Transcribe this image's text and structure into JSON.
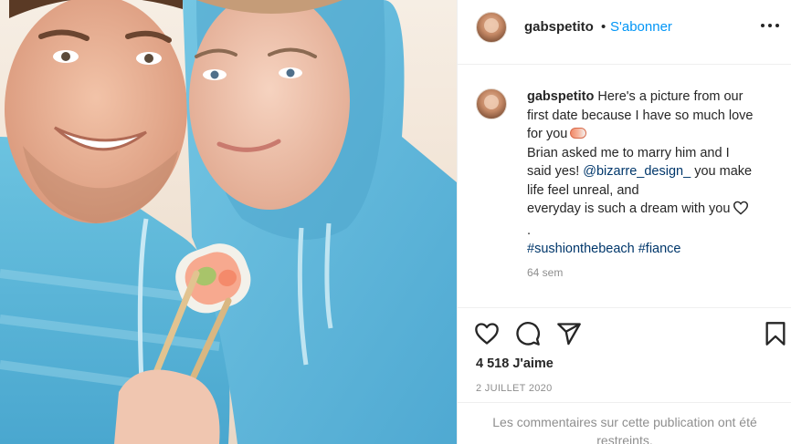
{
  "post": {
    "photo_label": "couple-selfie-photo",
    "author": {
      "username": "gabspetito",
      "follow_separator": "•",
      "follow_label": "S'abonner",
      "more_label": "•••"
    },
    "caption": {
      "username": "gabspetito",
      "line1": "Here's a picture from our",
      "line2": "first date because I have so much love",
      "line3": "for you",
      "line4": "Brian asked me to marry him and I",
      "line5_start": "said yes!",
      "mention": "@bizarre_design_",
      "line5_end": "you make",
      "line6": "life feel unreal, and",
      "line7": "everyday is such a dream with you",
      "line8": ".",
      "hashtags": "#sushionthebeach #fiance",
      "time_ago": "64 sem"
    },
    "actions": {
      "like_icon": "heart-icon",
      "comment_icon": "comment-icon",
      "share_icon": "share-icon",
      "save_icon": "bookmark-icon"
    },
    "likes_text": "4 518 J'aime",
    "date_text": "2 JUILLET 2020",
    "comments_notice": "Les commentaires sur cette publication ont été restreints."
  },
  "colors": {
    "link_blue": "#0095f6",
    "hashtag_blue": "#00376b",
    "muted_gray": "#8e8e8e",
    "text": "#262626",
    "hoodie_blue": "#5fb8d9"
  }
}
